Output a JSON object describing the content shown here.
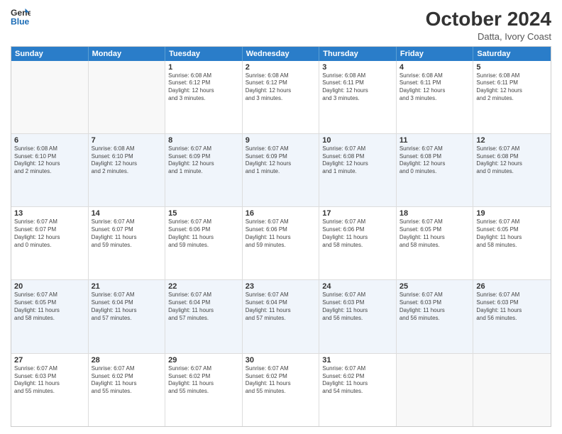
{
  "logo": {
    "line1": "General",
    "line2": "Blue"
  },
  "title": "October 2024",
  "subtitle": "Datta, Ivory Coast",
  "header_days": [
    "Sunday",
    "Monday",
    "Tuesday",
    "Wednesday",
    "Thursday",
    "Friday",
    "Saturday"
  ],
  "weeks": [
    [
      {
        "day": "",
        "info": ""
      },
      {
        "day": "",
        "info": ""
      },
      {
        "day": "1",
        "info": "Sunrise: 6:08 AM\nSunset: 6:12 PM\nDaylight: 12 hours\nand 3 minutes."
      },
      {
        "day": "2",
        "info": "Sunrise: 6:08 AM\nSunset: 6:12 PM\nDaylight: 12 hours\nand 3 minutes."
      },
      {
        "day": "3",
        "info": "Sunrise: 6:08 AM\nSunset: 6:11 PM\nDaylight: 12 hours\nand 3 minutes."
      },
      {
        "day": "4",
        "info": "Sunrise: 6:08 AM\nSunset: 6:11 PM\nDaylight: 12 hours\nand 3 minutes."
      },
      {
        "day": "5",
        "info": "Sunrise: 6:08 AM\nSunset: 6:11 PM\nDaylight: 12 hours\nand 2 minutes."
      }
    ],
    [
      {
        "day": "6",
        "info": "Sunrise: 6:08 AM\nSunset: 6:10 PM\nDaylight: 12 hours\nand 2 minutes."
      },
      {
        "day": "7",
        "info": "Sunrise: 6:08 AM\nSunset: 6:10 PM\nDaylight: 12 hours\nand 2 minutes."
      },
      {
        "day": "8",
        "info": "Sunrise: 6:07 AM\nSunset: 6:09 PM\nDaylight: 12 hours\nand 1 minute."
      },
      {
        "day": "9",
        "info": "Sunrise: 6:07 AM\nSunset: 6:09 PM\nDaylight: 12 hours\nand 1 minute."
      },
      {
        "day": "10",
        "info": "Sunrise: 6:07 AM\nSunset: 6:08 PM\nDaylight: 12 hours\nand 1 minute."
      },
      {
        "day": "11",
        "info": "Sunrise: 6:07 AM\nSunset: 6:08 PM\nDaylight: 12 hours\nand 0 minutes."
      },
      {
        "day": "12",
        "info": "Sunrise: 6:07 AM\nSunset: 6:08 PM\nDaylight: 12 hours\nand 0 minutes."
      }
    ],
    [
      {
        "day": "13",
        "info": "Sunrise: 6:07 AM\nSunset: 6:07 PM\nDaylight: 12 hours\nand 0 minutes."
      },
      {
        "day": "14",
        "info": "Sunrise: 6:07 AM\nSunset: 6:07 PM\nDaylight: 11 hours\nand 59 minutes."
      },
      {
        "day": "15",
        "info": "Sunrise: 6:07 AM\nSunset: 6:06 PM\nDaylight: 11 hours\nand 59 minutes."
      },
      {
        "day": "16",
        "info": "Sunrise: 6:07 AM\nSunset: 6:06 PM\nDaylight: 11 hours\nand 59 minutes."
      },
      {
        "day": "17",
        "info": "Sunrise: 6:07 AM\nSunset: 6:06 PM\nDaylight: 11 hours\nand 58 minutes."
      },
      {
        "day": "18",
        "info": "Sunrise: 6:07 AM\nSunset: 6:05 PM\nDaylight: 11 hours\nand 58 minutes."
      },
      {
        "day": "19",
        "info": "Sunrise: 6:07 AM\nSunset: 6:05 PM\nDaylight: 11 hours\nand 58 minutes."
      }
    ],
    [
      {
        "day": "20",
        "info": "Sunrise: 6:07 AM\nSunset: 6:05 PM\nDaylight: 11 hours\nand 58 minutes."
      },
      {
        "day": "21",
        "info": "Sunrise: 6:07 AM\nSunset: 6:04 PM\nDaylight: 11 hours\nand 57 minutes."
      },
      {
        "day": "22",
        "info": "Sunrise: 6:07 AM\nSunset: 6:04 PM\nDaylight: 11 hours\nand 57 minutes."
      },
      {
        "day": "23",
        "info": "Sunrise: 6:07 AM\nSunset: 6:04 PM\nDaylight: 11 hours\nand 57 minutes."
      },
      {
        "day": "24",
        "info": "Sunrise: 6:07 AM\nSunset: 6:03 PM\nDaylight: 11 hours\nand 56 minutes."
      },
      {
        "day": "25",
        "info": "Sunrise: 6:07 AM\nSunset: 6:03 PM\nDaylight: 11 hours\nand 56 minutes."
      },
      {
        "day": "26",
        "info": "Sunrise: 6:07 AM\nSunset: 6:03 PM\nDaylight: 11 hours\nand 56 minutes."
      }
    ],
    [
      {
        "day": "27",
        "info": "Sunrise: 6:07 AM\nSunset: 6:03 PM\nDaylight: 11 hours\nand 55 minutes."
      },
      {
        "day": "28",
        "info": "Sunrise: 6:07 AM\nSunset: 6:02 PM\nDaylight: 11 hours\nand 55 minutes."
      },
      {
        "day": "29",
        "info": "Sunrise: 6:07 AM\nSunset: 6:02 PM\nDaylight: 11 hours\nand 55 minutes."
      },
      {
        "day": "30",
        "info": "Sunrise: 6:07 AM\nSunset: 6:02 PM\nDaylight: 11 hours\nand 55 minutes."
      },
      {
        "day": "31",
        "info": "Sunrise: 6:07 AM\nSunset: 6:02 PM\nDaylight: 11 hours\nand 54 minutes."
      },
      {
        "day": "",
        "info": ""
      },
      {
        "day": "",
        "info": ""
      }
    ]
  ]
}
